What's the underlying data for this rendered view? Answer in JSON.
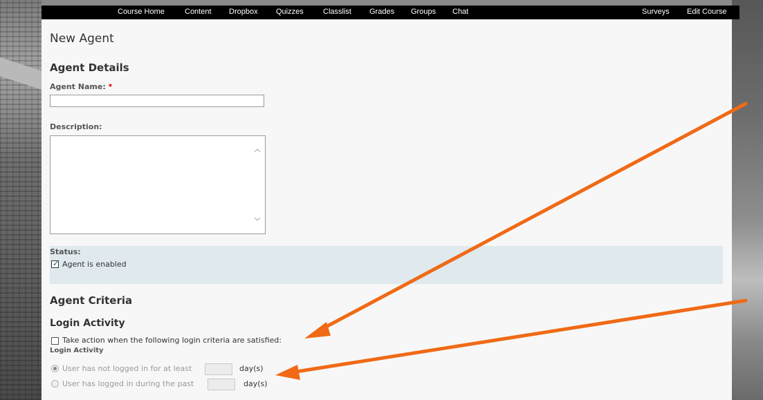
{
  "nav": {
    "items": [
      "Course Home",
      "Content",
      "Dropbox",
      "Quizzes",
      "Classlist",
      "Grades",
      "Groups",
      "Chat"
    ],
    "right_items": [
      "Surveys",
      "Edit Course"
    ]
  },
  "page": {
    "title": "New Agent"
  },
  "agent_details": {
    "heading": "Agent Details",
    "name_label": "Agent Name:",
    "name_required": "*",
    "name_value": "",
    "description_label": "Description:",
    "description_value": ""
  },
  "status": {
    "label": "Status:",
    "enabled_label": "Agent is enabled",
    "enabled_checked": true
  },
  "agent_criteria": {
    "heading": "Agent Criteria",
    "login_heading": "Login Activity",
    "take_action_label": "Take action when the following login criteria are satisfied:",
    "take_action_checked": false,
    "login_activity_sublabel": "Login Activity",
    "option_not_logged": "User has not logged in for at least",
    "option_logged": "User has logged in during the past",
    "days_unit": "day(s)"
  },
  "colors": {
    "annotation_arrow": "#f06a16",
    "navbar": "#000000",
    "status_panel": "#dfe9ee"
  }
}
